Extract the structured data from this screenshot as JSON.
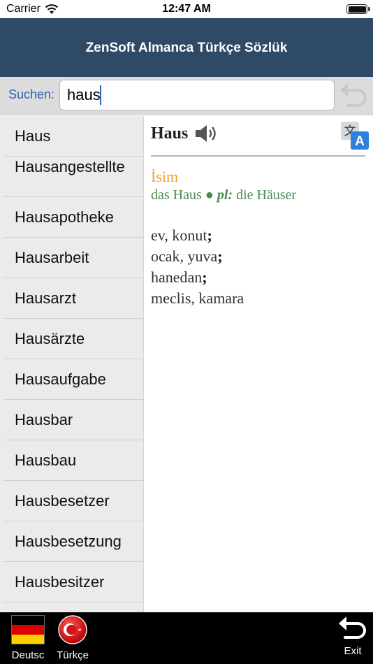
{
  "status": {
    "carrier": "Carrier",
    "time": "12:47 AM"
  },
  "header": {
    "title": "ZenSoft Almanca Türkçe Sözlük"
  },
  "search": {
    "label": "Suchen:",
    "value": "haus"
  },
  "word_list": [
    "Haus",
    "Hausangestellte",
    "Hausapotheke",
    "Hausarbeit",
    "Hausarzt",
    "Hausärzte",
    "Hausaufgabe",
    "Hausbar",
    "Hausbau",
    "Hausbesetzer",
    "Hausbesetzung",
    "Hausbesitzer"
  ],
  "definition": {
    "word": "Haus",
    "part_of_speech": "İsim",
    "article_form": "das Haus",
    "bullet": "●",
    "plural_label": "pl:",
    "plural_form": "die Häuser",
    "meanings": [
      "ev, konut",
      "ocak, yuva",
      "hanedan",
      "meclis, kamara"
    ],
    "separator": ";"
  },
  "bottom": {
    "german": "Deutsc",
    "turkish": "Türkçe",
    "exit": "Exit"
  },
  "colors": {
    "header": "#2f4a66",
    "search_label": "#2a64b7",
    "pos": "#f0a020",
    "grammar": "#4a8a50"
  }
}
